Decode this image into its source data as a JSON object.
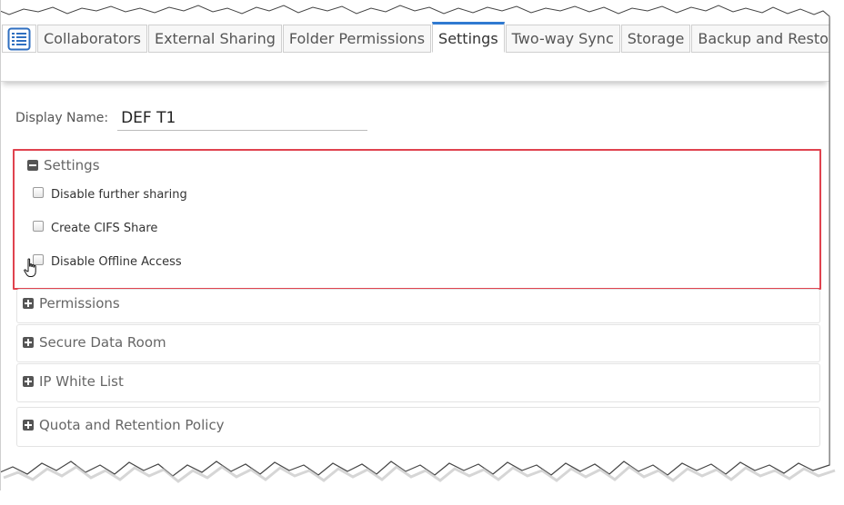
{
  "tabs": [
    {
      "label": "Collaborators"
    },
    {
      "label": "External Sharing"
    },
    {
      "label": "Folder Permissions"
    },
    {
      "label": "Settings"
    },
    {
      "label": "Two-way Sync"
    },
    {
      "label": "Storage"
    },
    {
      "label": "Backup and Restore"
    }
  ],
  "active_tab": "Settings",
  "tab_icon": "list-icon",
  "display_name": {
    "label": "Display Name:",
    "value": "DEF T1"
  },
  "settings_section": {
    "title": "Settings",
    "expanded": true,
    "options": [
      {
        "label": "Disable further sharing",
        "checked": false
      },
      {
        "label": "Create CIFS Share",
        "checked": false
      },
      {
        "label": "Disable Offline Access",
        "checked": false
      }
    ]
  },
  "collapsed_sections": [
    {
      "title": "Permissions"
    },
    {
      "title": "Secure Data Room"
    },
    {
      "title": "IP White List"
    },
    {
      "title": "Quota and Retention Policy"
    }
  ],
  "colors": {
    "highlight": "#e0434f",
    "active_tab_accent": "#2f7ad1"
  }
}
